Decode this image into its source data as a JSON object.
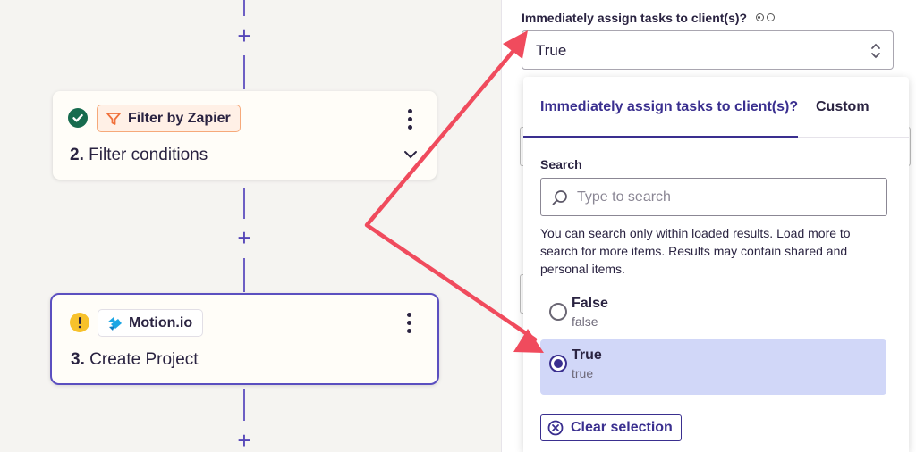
{
  "canvas": {
    "steps": [
      {
        "app": "Filter by Zapier",
        "number": "2.",
        "title": "Filter conditions",
        "status": "complete"
      },
      {
        "app": "Motion.io",
        "number": "3.",
        "title": "Create Project",
        "status": "warning"
      }
    ]
  },
  "panel": {
    "field_label": "Immediately assign tasks to client(s)?",
    "selected_value": "True",
    "dropdown": {
      "tabs": [
        "Immediately assign tasks to client(s)?",
        "Custom"
      ],
      "active_tab": 0,
      "search_label": "Search",
      "search_placeholder": "Type to search",
      "search_value": "",
      "hint": "You can search only within loaded results. Load more to search for more items. Results may contain shared and personal items.",
      "options": [
        {
          "label": "False",
          "value": "false",
          "selected": false
        },
        {
          "label": "True",
          "value": "true",
          "selected": true
        }
      ],
      "clear_label": "Clear selection"
    }
  },
  "colors": {
    "accent": "#3a2f8f",
    "selected_bg": "#d1d7f8",
    "annotation_arrow": "#f04b5d",
    "step_success": "#166b4e",
    "step_warning": "#f7c12b"
  }
}
